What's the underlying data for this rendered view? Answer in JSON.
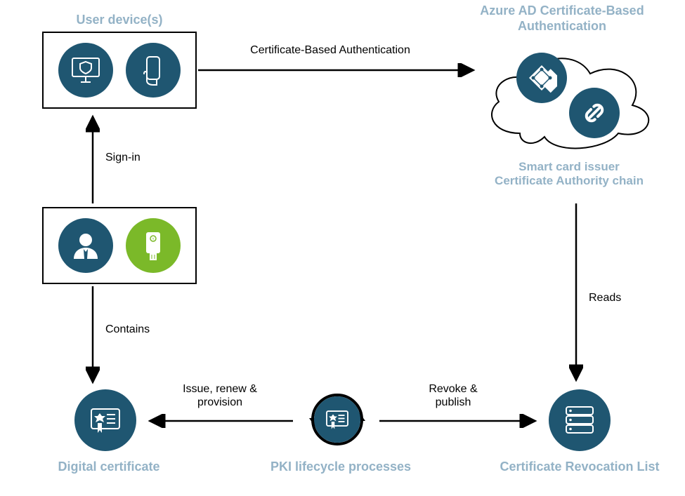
{
  "colors": {
    "teal": "#1f5671",
    "green": "#7bb929",
    "heading": "#93b2c6"
  },
  "nodes": {
    "user_devices": {
      "label": "User device(s)",
      "icons": [
        "monitor-shield-icon",
        "mobile-hand-icon"
      ]
    },
    "azure_ad": {
      "label": "Azure AD Certificate-Based Authentication",
      "sublabel": "Smart card issuer\nCertificate Authority chain",
      "icons": [
        "diamond-nodes-icon",
        "chain-link-icon",
        "cloud-icon"
      ]
    },
    "user_smartcard": {
      "icons": [
        "business-user-icon",
        "security-key-icon"
      ]
    },
    "digital_certificate": {
      "label": "Digital certificate",
      "icons": [
        "certificate-icon"
      ]
    },
    "pki_lifecycle": {
      "label": "PKI lifecycle processes",
      "icons": [
        "certificate-icon",
        "cycle-arrows-icon"
      ]
    },
    "crl": {
      "label": "Certificate Revocation List",
      "icons": [
        "server-list-icon"
      ]
    }
  },
  "edges": {
    "cba": {
      "label": "Certificate-Based Authentication"
    },
    "signin": {
      "label": "Sign-in"
    },
    "reads": {
      "label": "Reads"
    },
    "contains": {
      "label": "Contains"
    },
    "issue": {
      "label": "Issue, renew & provision"
    },
    "revoke": {
      "label": "Revoke & publish"
    }
  }
}
